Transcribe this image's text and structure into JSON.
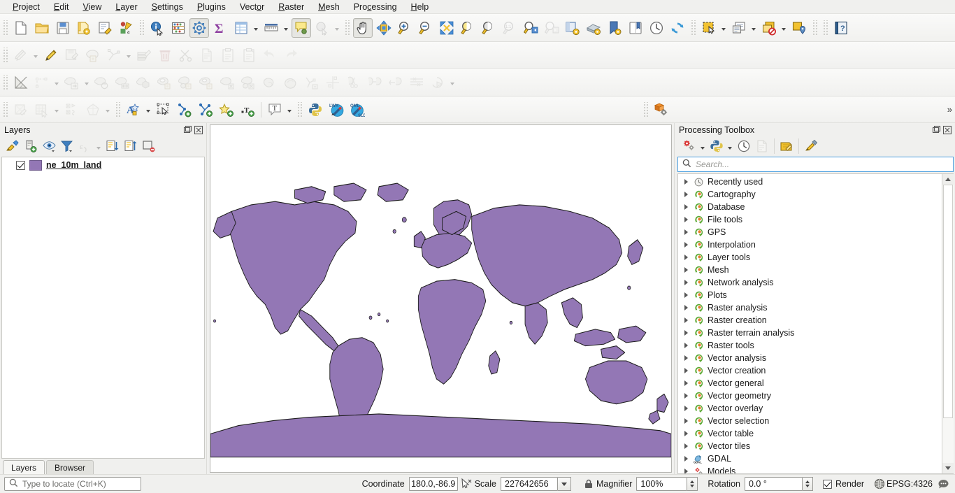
{
  "app": {
    "title": "QGIS"
  },
  "menubar": {
    "items": [
      {
        "label": "Project",
        "accel": "P"
      },
      {
        "label": "Edit",
        "accel": "E"
      },
      {
        "label": "View",
        "accel": "V"
      },
      {
        "label": "Layer",
        "accel": "L"
      },
      {
        "label": "Settings",
        "accel": "S"
      },
      {
        "label": "Plugins",
        "accel": "P"
      },
      {
        "label": "Vector",
        "accel": "o"
      },
      {
        "label": "Raster",
        "accel": "R"
      },
      {
        "label": "Mesh",
        "accel": "M"
      },
      {
        "label": "Processing",
        "accel": "c"
      },
      {
        "label": "Help",
        "accel": "H"
      }
    ]
  },
  "toolbars": {
    "project": [
      {
        "name": "new-project-icon",
        "title": "New Project"
      },
      {
        "name": "open-project-icon",
        "title": "Open Project"
      },
      {
        "name": "save-project-icon",
        "title": "Save Project"
      },
      {
        "name": "save-project-as-icon",
        "title": "Save Project As"
      },
      {
        "name": "new-print-layout-icon",
        "title": "New Print Layout"
      },
      {
        "name": "style-manager-icon",
        "title": "Style Manager"
      },
      {
        "name": "identify-features-icon",
        "title": "Identify Features"
      },
      {
        "name": "statistical-summary-icon",
        "title": "Statistical Summary"
      },
      {
        "name": "processing-toolbox-icon",
        "title": "Processing Toolbox"
      },
      {
        "name": "sum-field-icon",
        "title": "Field Calculator"
      },
      {
        "name": "attribute-table-icon",
        "title": "Open Attribute Table"
      },
      {
        "name": "measure-line-icon",
        "title": "Measure Line"
      },
      {
        "name": "map-tips-icon",
        "title": "Show Map Tips"
      },
      {
        "name": "run-feature-action-icon",
        "title": "Run Feature Action"
      },
      {
        "name": "pan-map-icon",
        "title": "Pan Map",
        "active": true
      },
      {
        "name": "pan-to-selection-icon",
        "title": "Pan Map to Selection"
      },
      {
        "name": "zoom-in-icon",
        "title": "Zoom In"
      },
      {
        "name": "zoom-out-icon",
        "title": "Zoom Out"
      },
      {
        "name": "zoom-full-icon",
        "title": "Zoom Full"
      },
      {
        "name": "zoom-to-selection-icon",
        "title": "Zoom to Selection"
      },
      {
        "name": "zoom-to-layer-icon",
        "title": "Zoom to Layer"
      },
      {
        "name": "zoom-native-icon",
        "title": "Zoom to Native Resolution"
      },
      {
        "name": "zoom-last-icon",
        "title": "Zoom Last"
      },
      {
        "name": "zoom-next-icon",
        "title": "Zoom Next"
      },
      {
        "name": "new-map-view-icon",
        "title": "New Map View"
      },
      {
        "name": "new-3d-map-view-icon",
        "title": "New 3D Map View"
      },
      {
        "name": "new-bookmark-icon",
        "title": "New Spatial Bookmark"
      },
      {
        "name": "show-bookmarks-icon",
        "title": "Show Spatial Bookmarks"
      },
      {
        "name": "temporal-controller-icon",
        "title": "Temporal Controller"
      },
      {
        "name": "refresh-icon",
        "title": "Refresh"
      },
      {
        "name": "select-features-icon",
        "title": "Select Features by Area"
      },
      {
        "name": "select-by-expression-icon",
        "title": "Select by Expression"
      },
      {
        "name": "deselect-features-icon",
        "title": "Deselect Features"
      },
      {
        "name": "select-location-icon",
        "title": "Select by Location"
      },
      {
        "name": "help-icon",
        "title": "Help"
      }
    ],
    "digitizing": [
      {
        "name": "current-edits-icon",
        "disabled": true
      },
      {
        "name": "toggle-editing-icon",
        "disabled": false
      },
      {
        "name": "save-layer-edits-icon",
        "disabled": true
      },
      {
        "name": "add-feature-icon",
        "disabled": true
      },
      {
        "name": "vertex-tool-icon",
        "disabled": true
      },
      {
        "name": "modify-attributes-icon",
        "disabled": true
      },
      {
        "name": "delete-selected-icon",
        "disabled": true
      },
      {
        "name": "cut-features-icon",
        "disabled": true
      },
      {
        "name": "copy-features-icon",
        "disabled": true
      },
      {
        "name": "paste-features-icon",
        "disabled": true
      },
      {
        "name": "paste-as-new-icon",
        "disabled": true
      },
      {
        "name": "undo-icon",
        "disabled": true
      },
      {
        "name": "redo-icon",
        "disabled": true
      }
    ],
    "advanced_digitizing": [
      {
        "name": "enable-advanced-digitizing-icon",
        "disabled": false
      },
      {
        "name": "trace-icon",
        "disabled": true
      },
      {
        "name": "move-feature-icon",
        "disabled": true
      },
      {
        "name": "rotate-feature-icon",
        "disabled": true
      },
      {
        "name": "scale-feature-icon",
        "disabled": true
      },
      {
        "name": "simplify-feature-icon",
        "disabled": true
      },
      {
        "name": "add-ring-icon",
        "disabled": true
      },
      {
        "name": "add-part-icon",
        "disabled": true
      },
      {
        "name": "fill-ring-icon",
        "disabled": true
      },
      {
        "name": "delete-ring-icon",
        "disabled": true
      },
      {
        "name": "delete-part-icon",
        "disabled": true
      },
      {
        "name": "reshape-features-icon",
        "disabled": true
      },
      {
        "name": "offset-curve-icon",
        "disabled": true
      },
      {
        "name": "reverse-line-icon",
        "disabled": true
      },
      {
        "name": "split-features-icon",
        "disabled": true
      },
      {
        "name": "split-parts-icon",
        "disabled": true
      },
      {
        "name": "merge-features-icon",
        "disabled": true
      },
      {
        "name": "merge-attributes-icon",
        "disabled": true
      },
      {
        "name": "rotate-point-symbols-icon",
        "disabled": true
      },
      {
        "name": "offset-point-symbol-icon",
        "disabled": true
      }
    ],
    "label_plugins": [
      {
        "name": "georeferencer-icon",
        "disabled": true
      },
      {
        "name": "raster-calculator-icon",
        "disabled": true
      },
      {
        "name": "mesh-calculator-icon",
        "disabled": true
      },
      {
        "name": "topology-checker-icon",
        "disabled": true
      },
      {
        "name": "highlight-pinned-labels-icon",
        "disabled": false
      },
      {
        "name": "pin-labels-icon",
        "disabled": false
      },
      {
        "name": "show-hide-labels-icon",
        "disabled": false
      },
      {
        "name": "move-label-icon",
        "disabled": false
      },
      {
        "name": "rotate-label-icon",
        "disabled": false
      },
      {
        "name": "change-label-icon",
        "disabled": false
      },
      {
        "name": "text-annotation-icon",
        "disabled": false
      },
      {
        "name": "python-console-icon",
        "disabled": false
      },
      {
        "name": "lwx-plugin-icon",
        "disabled": false
      },
      {
        "name": "qml-plugin-icon",
        "disabled": false
      },
      {
        "name": "plugin-manager-icon",
        "disabled": false
      }
    ],
    "overflow_label": "»"
  },
  "layers_panel": {
    "title": "Layers",
    "tools": [
      {
        "name": "open-layer-styling-icon",
        "title": "Open the Layer Styling panel"
      },
      {
        "name": "add-group-icon",
        "title": "Add Group"
      },
      {
        "name": "manage-map-themes-icon",
        "title": "Manage Map Themes"
      },
      {
        "name": "filter-legend-icon",
        "title": "Filter Legend by Map Content"
      },
      {
        "name": "filter-legend-expression-icon",
        "title": "Filter Legend by Expression",
        "disabled": true
      },
      {
        "name": "expand-all-icon",
        "title": "Expand All"
      },
      {
        "name": "collapse-all-icon",
        "title": "Collapse All"
      },
      {
        "name": "remove-layer-icon",
        "title": "Remove Layer/Group"
      }
    ],
    "layers": [
      {
        "name": "ne_10m_land",
        "checked": true,
        "swatch": "#9377b5"
      }
    ],
    "tabs": [
      {
        "label": "Layers",
        "selected": true
      },
      {
        "label": "Browser",
        "selected": false
      }
    ]
  },
  "processing_toolbox": {
    "title": "Processing Toolbox",
    "tools": [
      {
        "name": "models-icon",
        "title": "Models"
      },
      {
        "name": "scripts-icon",
        "title": "Scripts"
      },
      {
        "name": "history-icon",
        "title": "History"
      },
      {
        "name": "results-viewer-icon",
        "title": "Results Viewer",
        "disabled": true
      },
      {
        "name": "edit-model-icon",
        "title": "Edit Model"
      },
      {
        "name": "options-icon",
        "title": "Options"
      }
    ],
    "search": {
      "placeholder": "Search...",
      "value": ""
    },
    "tree": [
      {
        "label": "Recently used",
        "icon": "clock-icon"
      },
      {
        "label": "Cartography",
        "icon": "qgis-icon"
      },
      {
        "label": "Database",
        "icon": "qgis-icon"
      },
      {
        "label": "File tools",
        "icon": "qgis-icon"
      },
      {
        "label": "GPS",
        "icon": "qgis-icon"
      },
      {
        "label": "Interpolation",
        "icon": "qgis-icon"
      },
      {
        "label": "Layer tools",
        "icon": "qgis-icon"
      },
      {
        "label": "Mesh",
        "icon": "qgis-icon"
      },
      {
        "label": "Network analysis",
        "icon": "qgis-icon"
      },
      {
        "label": "Plots",
        "icon": "qgis-icon"
      },
      {
        "label": "Raster analysis",
        "icon": "qgis-icon"
      },
      {
        "label": "Raster creation",
        "icon": "qgis-icon"
      },
      {
        "label": "Raster terrain analysis",
        "icon": "qgis-icon"
      },
      {
        "label": "Raster tools",
        "icon": "qgis-icon"
      },
      {
        "label": "Vector analysis",
        "icon": "qgis-icon"
      },
      {
        "label": "Vector creation",
        "icon": "qgis-icon"
      },
      {
        "label": "Vector general",
        "icon": "qgis-icon"
      },
      {
        "label": "Vector geometry",
        "icon": "qgis-icon"
      },
      {
        "label": "Vector overlay",
        "icon": "qgis-icon"
      },
      {
        "label": "Vector selection",
        "icon": "qgis-icon"
      },
      {
        "label": "Vector table",
        "icon": "qgis-icon"
      },
      {
        "label": "Vector tiles",
        "icon": "qgis-icon"
      },
      {
        "label": "GDAL",
        "icon": "gdal-icon"
      },
      {
        "label": "Models",
        "icon": "models-icon"
      }
    ]
  },
  "map": {
    "land_fill": "#9377b5",
    "land_stroke": "#1c1c1c",
    "background": "#ffffff"
  },
  "statusbar": {
    "locator_placeholder": "Type to locate (Ctrl+K)",
    "coordinate_label": "Coordinate",
    "coordinate_value": "180.0,-86.9",
    "scale_label": "Scale",
    "scale_value": "227642656",
    "magnifier_label": "Magnifier",
    "magnifier_value": "100%",
    "rotation_label": "Rotation",
    "rotation_value": "0.0 °",
    "render_label": "Render",
    "render_checked": true,
    "crs_value": "EPSG:4326"
  }
}
